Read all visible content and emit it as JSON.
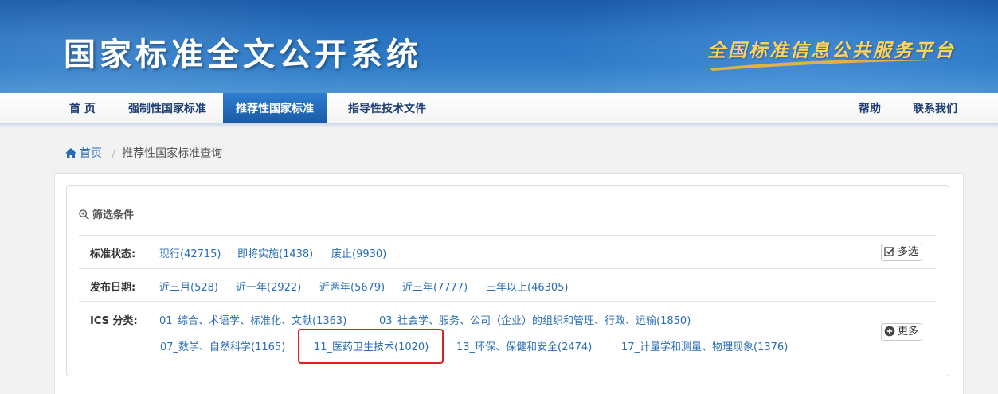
{
  "header": {
    "site_title": "国家标准全文公开系统",
    "platform_text": "全国标准信息公共服务平台"
  },
  "nav": {
    "items": [
      {
        "label": "首 页"
      },
      {
        "label": "强制性国家标准"
      },
      {
        "label": "推荐性国家标准",
        "active": true
      },
      {
        "label": "指导性技术文件"
      }
    ],
    "right_items": [
      {
        "label": "帮助"
      },
      {
        "label": "联系我们"
      }
    ]
  },
  "breadcrumb": {
    "home": "首页",
    "separator": "/",
    "current": "推荐性国家标准查询"
  },
  "filter": {
    "title": "筛选条件",
    "rows": [
      {
        "label": "标准状态:",
        "options": [
          "现行(42715)",
          "即将实施(1438)",
          "废止(9930)"
        ],
        "button": "多选"
      },
      {
        "label": "发布日期:",
        "options": [
          "近三月(528)",
          "近一年(2922)",
          "近两年(5679)",
          "近三年(7777)",
          "三年以上(46305)"
        ]
      },
      {
        "label": "ICS 分类:",
        "options_line1": [
          "01_综合、术语学、标准化、文献(1363)",
          "03_社会学、服务、公司（企业）的组织和管理、行政、运输(1850)"
        ],
        "options_line2": [
          "07_数学、自然科学(1165)",
          "11_医药卫生技术(1020)",
          "13_环保、保健和安全(2474)",
          "17_计量学和测量、物理现象(1376)"
        ],
        "button": "更多"
      }
    ]
  },
  "colors": {
    "link": "#2a6db5",
    "nav_active": "#1a5aa5",
    "highlight": "#e02020",
    "platform_text": "#ffd35a"
  }
}
